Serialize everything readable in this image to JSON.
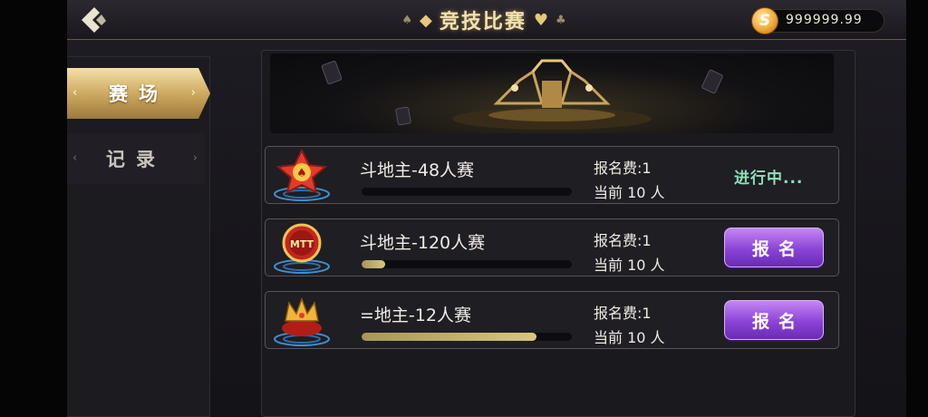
{
  "header": {
    "title": "竞技比赛",
    "coin_symbol": "S",
    "coin_balance": "999999.99"
  },
  "sidenav": {
    "items": [
      {
        "label": "赛场",
        "active": true
      },
      {
        "label": "记录",
        "active": false
      }
    ]
  },
  "matches": [
    {
      "name": "斗地主-48人赛",
      "fee_label": "报名费:1",
      "current_label": "当前 10 人",
      "progress": 0.0,
      "status": "进行中...",
      "icon": "spade-star-badge-icon"
    },
    {
      "name": "斗地主-120人赛",
      "fee_label": "报名费:1",
      "current_label": "当前 10 人",
      "progress": 0.11,
      "button_label": "报名",
      "icon": "mtt-badge-icon"
    },
    {
      "name": "=地主-12人赛",
      "fee_label": "报名费:1",
      "current_label": "当前 10 人",
      "progress": 0.83,
      "button_label": "报名",
      "icon": "crown-badge-icon"
    }
  ],
  "colors": {
    "gold_accent": "#caa55c",
    "signup_purple": "#8a43d6",
    "status_green": "#8fe0b8"
  }
}
